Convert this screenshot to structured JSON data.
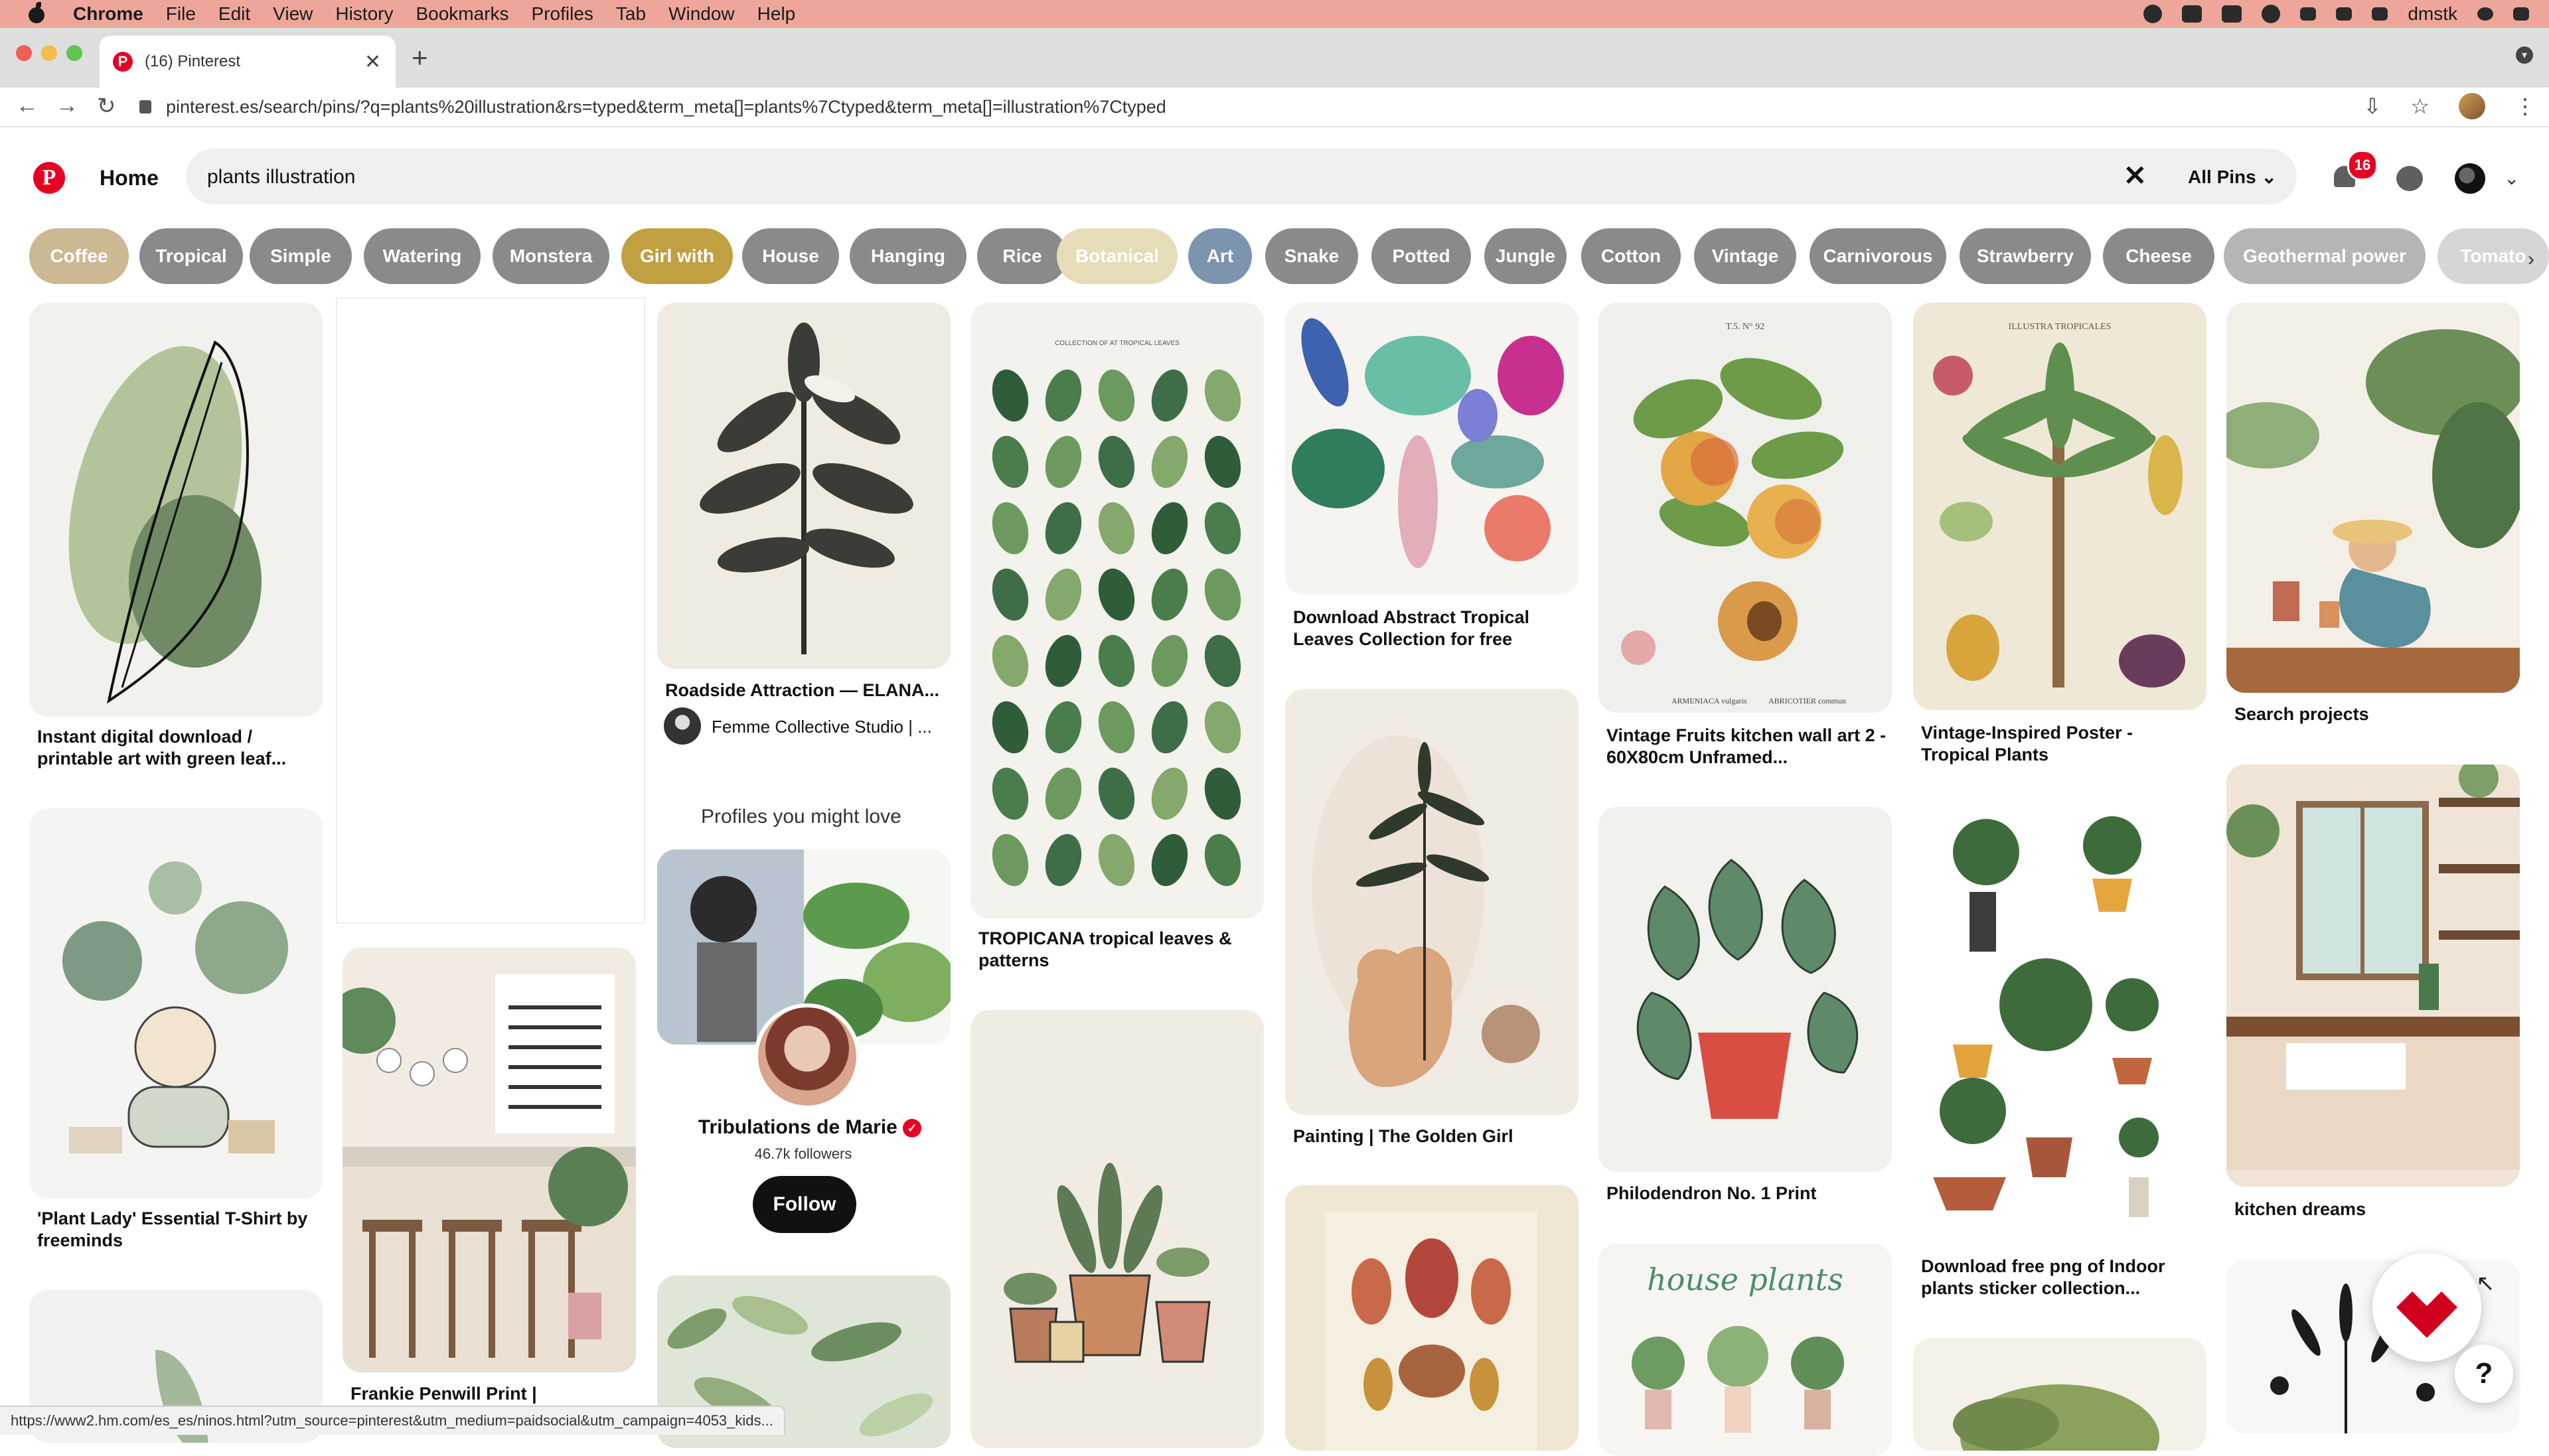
{
  "menubar": {
    "app_name": "Chrome",
    "menus": [
      "File",
      "Edit",
      "View",
      "History",
      "Bookmarks",
      "Profiles",
      "Tab",
      "Window",
      "Help"
    ],
    "user": "dmstk"
  },
  "browser": {
    "tab_title": "(16) Pinterest",
    "url": "pinterest.es/search/pins/?q=plants%20illustration&rs=typed&term_meta[]=plants%7Ctyped&term_meta[]=illustration%7Ctyped",
    "status_url": "https://www2.hm.com/es_es/ninos.html?utm_source=pinterest&utm_medium=paidsocial&utm_campaign=4053_kids..."
  },
  "header": {
    "home_label": "Home",
    "search_value": "plants illustration",
    "filter_label": "All Pins",
    "notification_count": "16"
  },
  "chips": [
    {
      "label": "Coffee",
      "color": "#cdb894"
    },
    {
      "label": "Tropical",
      "color": "#8a8a8a"
    },
    {
      "label": "Simple",
      "color": "#8a8a8a"
    },
    {
      "label": "Watering",
      "color": "#8a8a8a"
    },
    {
      "label": "Monstera",
      "color": "#8a8a8a"
    },
    {
      "label": "Girl with",
      "color": "#c1a042"
    },
    {
      "label": "House",
      "color": "#8a8a8a"
    },
    {
      "label": "Hanging",
      "color": "#8a8a8a"
    },
    {
      "label": "Rice",
      "color": "#8a8a8a"
    },
    {
      "label": "Botanical",
      "color": "#e6dcb8"
    },
    {
      "label": "Art",
      "color": "#7d94ae"
    },
    {
      "label": "Snake",
      "color": "#8a8a8a"
    },
    {
      "label": "Potted",
      "color": "#8a8a8a"
    },
    {
      "label": "Jungle",
      "color": "#8a8a8a"
    },
    {
      "label": "Cotton",
      "color": "#8a8a8a"
    },
    {
      "label": "Vintage",
      "color": "#8a8a8a"
    },
    {
      "label": "Carnivorous",
      "color": "#8a8a8a"
    },
    {
      "label": "Strawberry",
      "color": "#8a8a8a"
    },
    {
      "label": "Cheese",
      "color": "#8a8a8a"
    },
    {
      "label": "Geothermal power",
      "color": "#b5b5b5"
    },
    {
      "label": "Tomato",
      "color": "#d6d6d6"
    }
  ],
  "pins": {
    "c1a": "Instant digital download / printable art with green leaf...",
    "c1b": "'Plant Lady' Essential T-Shirt by freeminds",
    "c2b": "Frankie Penwill Print |",
    "c3a": "Roadside Attraction — ELANA...",
    "c3a_source": "Femme Collective Studio | ...",
    "c4a": "TROPICANA tropical leaves & patterns",
    "c5a": "Download Abstract Tropical Leaves Collection for free",
    "c5b": "Painting | The Golden Girl",
    "c6a": "Vintage Fruits kitchen wall art 2 - 60X80cm Unframed...",
    "c6b": "Philodendron No. 1 Print",
    "c7a": "Vintage-Inspired Poster - Tropical Plants",
    "c7b": "Download free png of Indoor plants sticker collection...",
    "c8a": "Search projects",
    "c8b": "kitchen dreams"
  },
  "profiles": {
    "heading": "Profiles you might love",
    "name": "Tribulations de Marie",
    "followers": "46.7k followers",
    "follow_label": "Follow"
  },
  "image_text": {
    "tropical_leaves_header": "COLLECTION OF AT TROPICAL LEAVES",
    "fruit_plate_number": "T.5. N° 92",
    "fruit_caption_left": "ARMENIACA vulgaris",
    "fruit_caption_right": "ABRICOTIER commun",
    "poster_title": "ILLUSTRA TROPICALES",
    "house_plants_title": "house plants"
  },
  "help_label": "?"
}
